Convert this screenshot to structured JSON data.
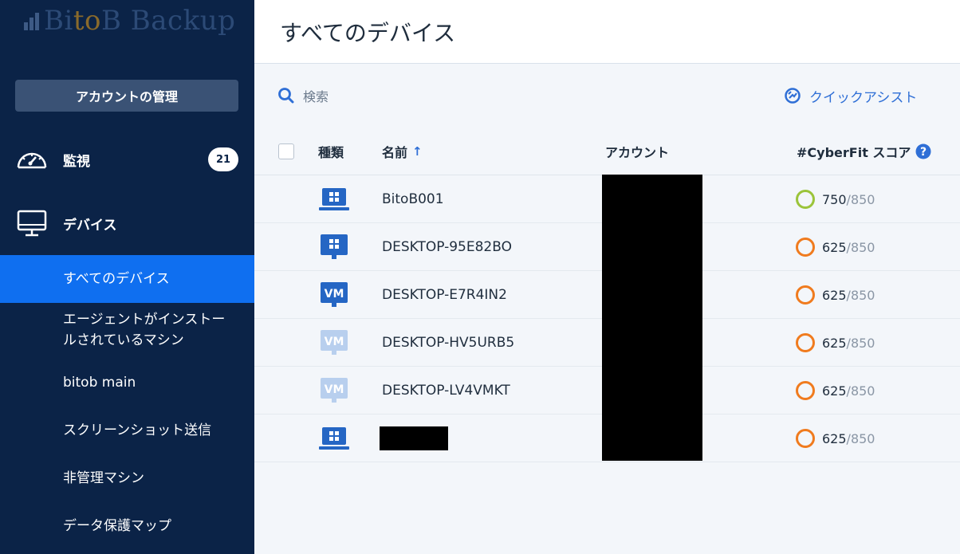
{
  "brand": {
    "text_pre": "Bi",
    "text_accent": "to",
    "text_post": "B Backup"
  },
  "sidebar": {
    "account_button": "アカウントの管理",
    "monitor": {
      "label": "監視",
      "badge": "21"
    },
    "devices": {
      "label": "デバイス"
    },
    "sub_items": [
      {
        "label": "すべてのデバイス",
        "active": true
      },
      {
        "label": "エージェントがインストールされているマシン"
      },
      {
        "label": "bitob main"
      },
      {
        "label": "スクリーンショット送信"
      },
      {
        "label": "非管理マシン"
      },
      {
        "label": "データ保護マップ"
      }
    ]
  },
  "header": {
    "title": "すべてのデバイス"
  },
  "toolbar": {
    "search_label": "検索",
    "quick_assist": "クイックアシスト"
  },
  "table": {
    "columns": {
      "type": "種類",
      "name": "名前",
      "sort_arrow": "↑",
      "account": "アカウント",
      "score": "#CyberFit スコア"
    },
    "rows": [
      {
        "type": "laptop",
        "name": "BitoB001",
        "score": "750",
        "max": "/850",
        "score_color": "#9bc43a"
      },
      {
        "type": "desktop",
        "name": "DESKTOP-95E82BO",
        "score": "625",
        "max": "/850",
        "score_color": "#f07b1e"
      },
      {
        "type": "vm",
        "name": "DESKTOP-E7R4IN2",
        "score": "625",
        "max": "/850",
        "score_color": "#f07b1e"
      },
      {
        "type": "vm-offline",
        "name": "DESKTOP-HV5URB5",
        "score": "625",
        "max": "/850",
        "score_color": "#f07b1e"
      },
      {
        "type": "vm-offline",
        "name": "DESKTOP-LV4VMKT",
        "score": "625",
        "max": "/850",
        "score_color": "#f07b1e"
      },
      {
        "type": "laptop",
        "name": "",
        "score": "625",
        "max": "/850",
        "score_color": "#f07b1e"
      }
    ]
  },
  "colors": {
    "sidebar_bg": "#0b2347",
    "active": "#0f6ff0",
    "accent_blue": "#2f6fd6",
    "vm_offline": "#b8cfee"
  }
}
